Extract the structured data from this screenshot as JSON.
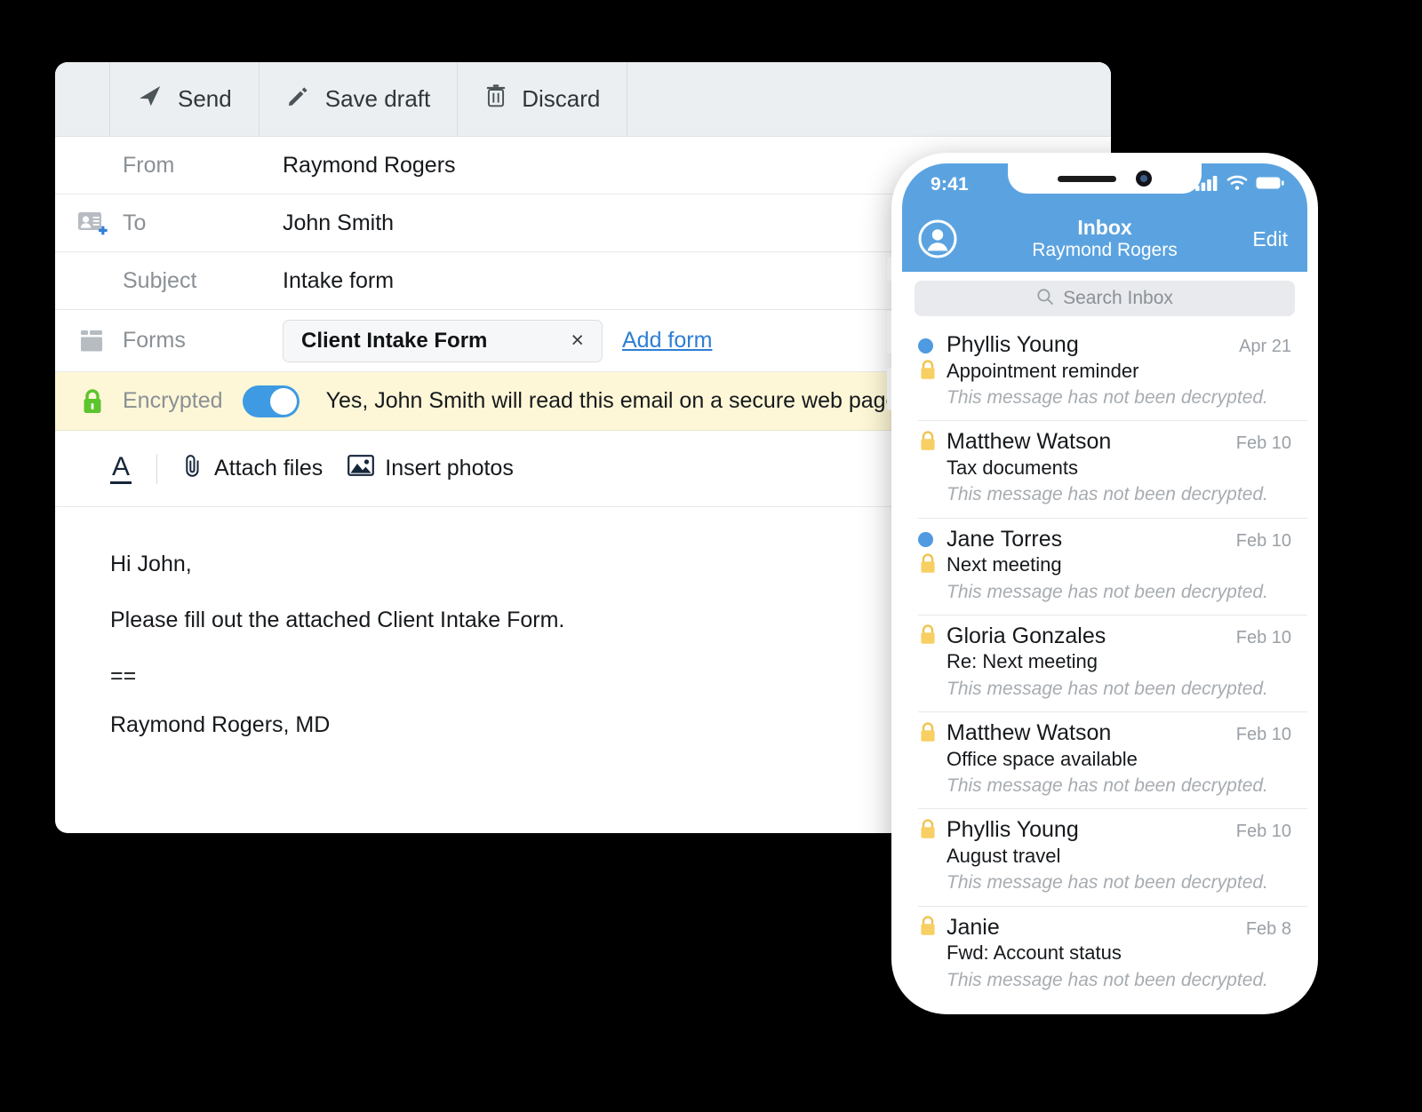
{
  "compose": {
    "toolbar": {
      "send_label": "Send",
      "save_draft_label": "Save draft",
      "discard_label": "Discard"
    },
    "fields": {
      "from_label": "From",
      "from_value": "Raymond Rogers",
      "to_label": "To",
      "to_value": "John Smith",
      "subject_label": "Subject",
      "subject_value": "Intake form",
      "forms_label": "Forms",
      "form_chip_name": "Client Intake Form",
      "form_chip_remove": "×",
      "add_form_label": "Add form"
    },
    "encrypted": {
      "label": "Encrypted",
      "toggle_state": "on",
      "message": "Yes, John Smith will read this email on a secure web page."
    },
    "format_bar": {
      "font_label": "A",
      "attach_files_label": "Attach files",
      "insert_photos_label": "Insert photos"
    },
    "body": {
      "line1": "Hi John,",
      "line2": "Please fill out the attached Client Intake Form.",
      "line3": "==",
      "line4": "Raymond Rogers, MD"
    }
  },
  "phone": {
    "status": {
      "time": "9:41"
    },
    "nav": {
      "title": "Inbox",
      "subtitle": "Raymond Rogers",
      "edit_label": "Edit"
    },
    "search": {
      "placeholder": "Search Inbox"
    },
    "messages": [
      {
        "sender": "Phyllis Young",
        "subject": "Appointment reminder",
        "preview": "This message has not been decrypted.",
        "date": "Apr 21",
        "unread": true
      },
      {
        "sender": "Matthew Watson",
        "subject": "Tax documents",
        "preview": "This message has not been decrypted.",
        "date": "Feb 10",
        "unread": false
      },
      {
        "sender": "Jane Torres",
        "subject": "Next meeting",
        "preview": "This message has not been decrypted.",
        "date": "Feb 10",
        "unread": true
      },
      {
        "sender": "Gloria Gonzales",
        "subject": "Re: Next meeting",
        "preview": "This message has not been decrypted.",
        "date": "Feb 10",
        "unread": false
      },
      {
        "sender": "Matthew Watson",
        "subject": "Office space available",
        "preview": "This message has not been decrypted.",
        "date": "Feb 10",
        "unread": false
      },
      {
        "sender": "Phyllis Young",
        "subject": "August travel",
        "preview": "This message has not been decrypted.",
        "date": "Feb 10",
        "unread": false
      },
      {
        "sender": "Janie",
        "subject": "Fwd: Account status",
        "preview": "This message has not been decrypted.",
        "date": "Feb 8",
        "unread": false
      }
    ]
  },
  "colors": {
    "accent_blue": "#5ba3e0",
    "link_blue": "#2d7fd3",
    "lock_green": "#5cc42c",
    "lock_gold": "#f6cf6a",
    "encrypt_banner": "#fdf7d7",
    "unread_dot": "#4f9ae0"
  }
}
